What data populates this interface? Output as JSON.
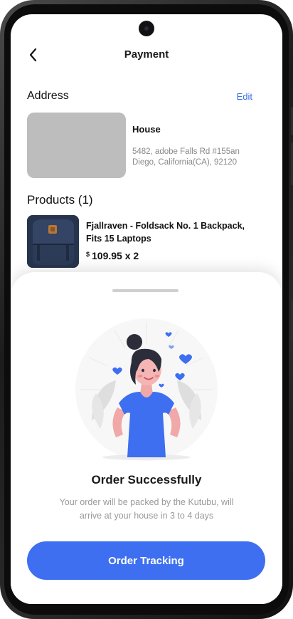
{
  "header": {
    "title": "Payment",
    "back_icon": "chevron-left-icon"
  },
  "address": {
    "section_title": "Address",
    "edit_label": "Edit",
    "name": "House",
    "line1": "5482, adobe Falls Rd #155an",
    "line2": "Diego, California(CA), 92120"
  },
  "products": {
    "section_title": "Products (1)",
    "items": [
      {
        "name_line1": "Fjallraven - Foldsack No. 1 Backpack,",
        "name_line2": "Fits 15 Laptops",
        "currency": "$",
        "price_qty": "109.95 x 2"
      }
    ]
  },
  "sheet": {
    "title": "Order Successfully",
    "message_line1": "Your order will be packed by the Kutubu, will",
    "message_line2": "arrive at your house in 3 to 4 days",
    "button_label": "Order Tracking",
    "illustration": "woman-success-illustration"
  },
  "colors": {
    "accent": "#3d6ff0",
    "link": "#3b6de8",
    "placeholder": "#bdbdbd"
  }
}
